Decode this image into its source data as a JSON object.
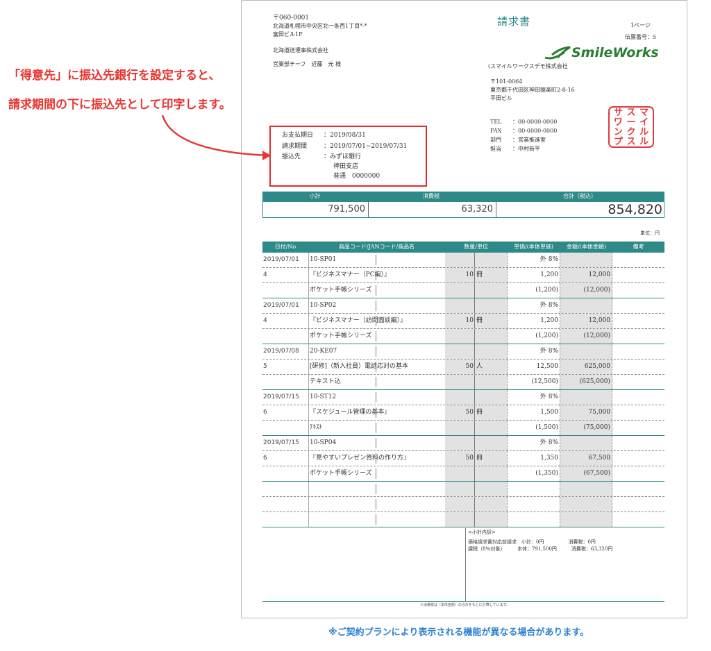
{
  "sender": {
    "postal": "〒060-0001",
    "address": "北海道札幌市中央区北一条西1丁目*-*",
    "building": "富田ビル1F",
    "company": "北海道送運事株式会社",
    "contact": "営業部チーフ　近藤　元 様"
  },
  "document": {
    "title": "請求書",
    "page": "1ページ",
    "voucher": "伝票番号：5"
  },
  "logo": {
    "text": "SmileWorks",
    "color": "#2a7e32"
  },
  "issuer": {
    "company": "(スマイルワークスデモ株式会社",
    "postal": "〒101-0064",
    "address": "東京都千代田区神田猿楽町2-8-16",
    "building": "平田ビル",
    "tel_label": "TEL",
    "tel": "：00-0000-0000",
    "fax_label": "FAX",
    "fax": "：00-0000-0000",
    "dept_label": "部門",
    "dept": "：営業推進室",
    "staff_label": "担当",
    "staff": "：中村新平"
  },
  "stamp": {
    "chars": [
      "サ",
      "ス",
      "マ",
      "ワ",
      "ー",
      "イ",
      "ン",
      "ク",
      "ル",
      "プ",
      "ス",
      "ル"
    ],
    "color": "#e03a3a"
  },
  "payment": {
    "due_label": "お支払期日",
    "due": "：2019/08/31",
    "period_label": "請求期間",
    "period": "：2019/07/01~2019/07/31",
    "bank_label": "振込先",
    "bank": "：みずほ銀行",
    "branch": "神田支店",
    "account": "普通　0000000"
  },
  "summary": {
    "headers": [
      "小計",
      "消費税",
      "合計（税込）"
    ],
    "subtotal": "791,500",
    "tax": "63,320",
    "total": "854,820",
    "unit": "単位：円"
  },
  "table": {
    "headers": [
      "日付/No",
      "商品コード/JANコード/商品名",
      "数量/単位",
      "単価/(本体単価)",
      "金額/(本体金額)",
      "備考"
    ],
    "rows": [
      {
        "date": "2019/07/01",
        "name": "10-SP01",
        "qty": "",
        "unit": "",
        "price": "外 8%",
        "amount": "",
        "grp": false
      },
      {
        "date": "4",
        "name": "『ビジネスマナー（PC編）』",
        "qty": "10",
        "unit": "冊",
        "price": "1,200",
        "amount": "12,000",
        "grp": false
      },
      {
        "date": "",
        "name": "ポケット手帳シリーズ",
        "qty": "",
        "unit": "",
        "price": "(1,200)",
        "amount": "(12,000)",
        "grp": true
      },
      {
        "date": "2019/07/01",
        "name": "10-SP02",
        "qty": "",
        "unit": "",
        "price": "外 8%",
        "amount": "",
        "grp": false
      },
      {
        "date": "4",
        "name": "『ビジネスマナー（訪問面談編）』",
        "qty": "10",
        "unit": "冊",
        "price": "1,200",
        "amount": "12,000",
        "grp": false
      },
      {
        "date": "",
        "name": "ポケット手帳シリーズ",
        "qty": "",
        "unit": "",
        "price": "(1,200)",
        "amount": "(12,000)",
        "grp": true
      },
      {
        "date": "2019/07/08",
        "name": "20-KE07",
        "qty": "",
        "unit": "",
        "price": "外 8%",
        "amount": "",
        "grp": false
      },
      {
        "date": "5",
        "name": "[研修]（新入社員）電話応対の基本",
        "qty": "50",
        "unit": "人",
        "price": "12,500",
        "amount": "625,000",
        "grp": false
      },
      {
        "date": "",
        "name": "テキスト込",
        "qty": "",
        "unit": "",
        "price": "(12,500)",
        "amount": "(625,000)",
        "grp": true
      },
      {
        "date": "2019/07/15",
        "name": "10-ST12",
        "qty": "",
        "unit": "",
        "price": "外 8%",
        "amount": "",
        "grp": false
      },
      {
        "date": "6",
        "name": "『スケジュール管理の基本』",
        "qty": "50",
        "unit": "冊",
        "price": "1,500",
        "amount": "75,000",
        "grp": false
      },
      {
        "date": "",
        "name": "ﾃｷｽﾄ",
        "qty": "",
        "unit": "",
        "price": "(1,500)",
        "amount": "(75,000)",
        "grp": true
      },
      {
        "date": "2019/07/15",
        "name": "10-SP04",
        "qty": "",
        "unit": "",
        "price": "外 8%",
        "amount": "",
        "grp": false
      },
      {
        "date": "6",
        "name": "『見やすいプレゼン資料の作り方』",
        "qty": "50",
        "unit": "冊",
        "price": "1,350",
        "amount": "67,500",
        "grp": false
      },
      {
        "date": "",
        "name": "ポケット手帳シリーズ",
        "qty": "",
        "unit": "",
        "price": "(1,350)",
        "amount": "(67,500)",
        "grp": true
      },
      {
        "date": "",
        "name": "",
        "qty": "",
        "unit": "",
        "price": "",
        "amount": "",
        "grp": false
      },
      {
        "date": "",
        "name": "",
        "qty": "",
        "unit": "",
        "price": "",
        "amount": "",
        "grp": false
      },
      {
        "date": "",
        "name": "",
        "qty": "",
        "unit": "",
        "price": "",
        "amount": "",
        "grp": true
      }
    ]
  },
  "subtotal_breakdown": {
    "title": "<小計内訳>",
    "line1": "適格請求書対応前請求　小計：0円　　　　　消費税：0円",
    "line2": "課税（8％対象）　　　本体：791,500円　　　消費税：63,320円"
  },
  "footer_note": "※消費税は（本体金額）の合計をもとに計算しています。",
  "annotation": {
    "line1": "「得意先」に振込先銀行を設定すると、",
    "line2": "請求期間の下に振込先として印字します。",
    "color": "#e83530"
  },
  "disclaimer": "※ご契約プランにより表示される機能が異なる場合があります。"
}
